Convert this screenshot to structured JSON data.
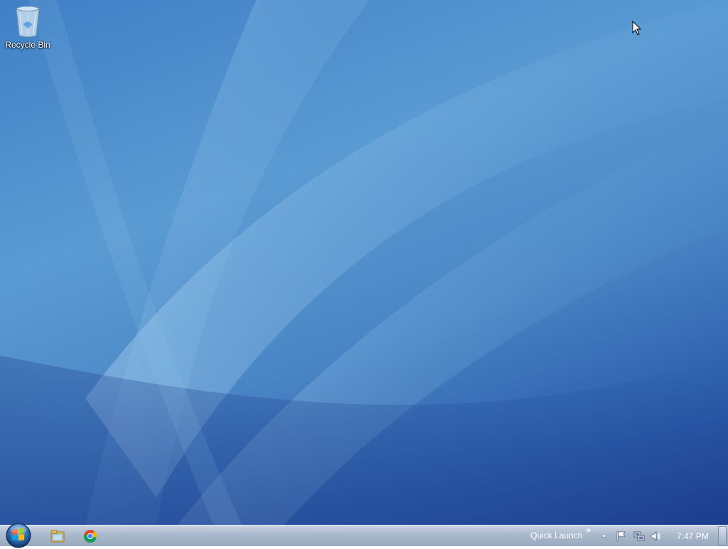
{
  "desktop": {
    "icons": [
      {
        "label": "Recycle Bin",
        "icon": "recycle-bin-icon"
      }
    ]
  },
  "taskbar": {
    "start_icon": "windows-start-icon",
    "pinned": [
      {
        "icon": "file-explorer-icon"
      },
      {
        "icon": "chrome-icon"
      }
    ],
    "quick_launch_label": "Quick Launch",
    "quick_launch_chevron": "»",
    "tray": {
      "icons": [
        "show-hidden-icons-icon",
        "action-center-flag-icon",
        "network-icon",
        "volume-icon"
      ]
    },
    "clock": "7:47 PM"
  },
  "colors": {
    "wallpaper_light": "#6aa6d9",
    "wallpaper_dark": "#1e3f8f",
    "taskbar": "#a9b8cb"
  }
}
